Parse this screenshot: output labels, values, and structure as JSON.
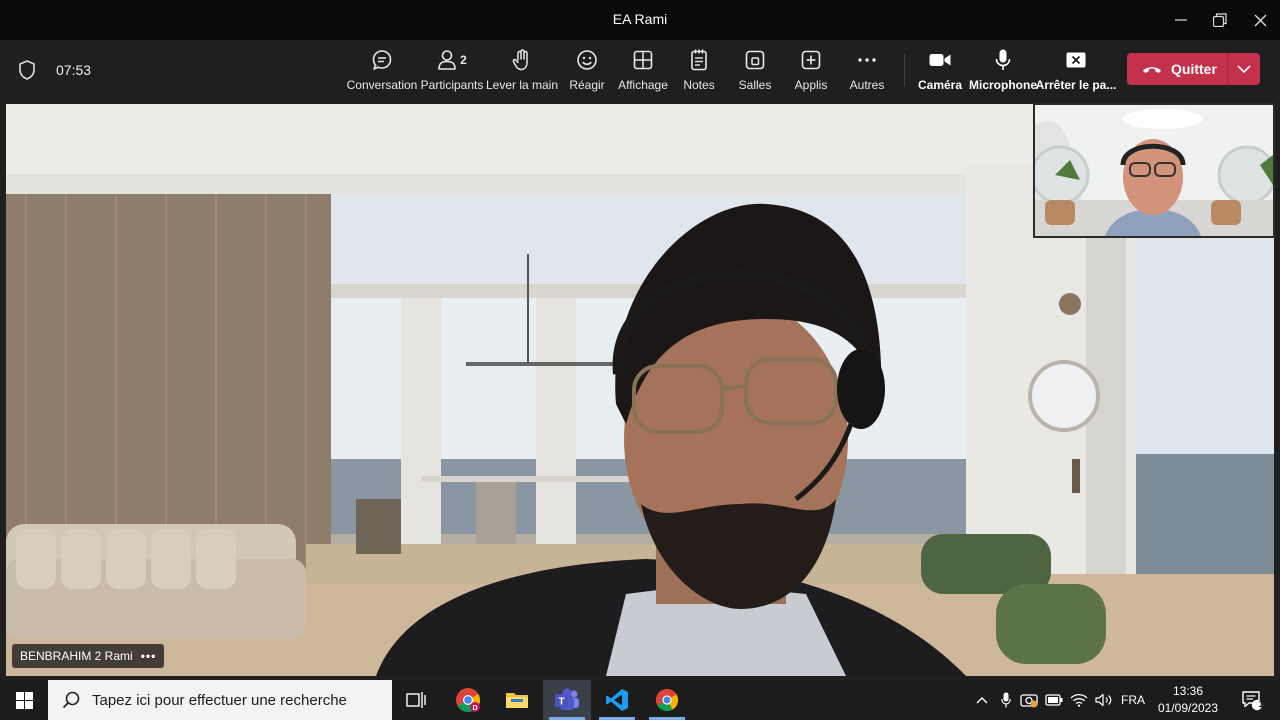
{
  "window": {
    "title": "EA Rami"
  },
  "meeting": {
    "elapsed": "07:53",
    "participants_count": "2",
    "toolbar": [
      {
        "key": "conversation",
        "label": "Conversation"
      },
      {
        "key": "participants",
        "label": "Participants"
      },
      {
        "key": "raise_hand",
        "label": "Lever la main"
      },
      {
        "key": "react",
        "label": "Réagir"
      },
      {
        "key": "view",
        "label": "Affichage"
      },
      {
        "key": "notes",
        "label": "Notes"
      },
      {
        "key": "rooms",
        "label": "Salles"
      },
      {
        "key": "apps",
        "label": "Applis"
      },
      {
        "key": "more",
        "label": "Autres"
      },
      {
        "key": "camera",
        "label": "Caméra"
      },
      {
        "key": "microphone",
        "label": "Microphone"
      },
      {
        "key": "share_stop",
        "label": "Arrêter le pa..."
      }
    ],
    "leave_label": "Quitter",
    "speaker_name": "BENBRAHIM 2 Rami",
    "more_dots": "•••"
  },
  "taskbar": {
    "search_placeholder": "Tapez ici pour effectuer une recherche",
    "language": "FRA",
    "time": "13:36",
    "date": "01/09/2023",
    "notification_count": "1"
  },
  "colors": {
    "leave_button": "#c4314b",
    "toolbar_bg": "#1f1f1f",
    "titlebar_bg": "#0a0a0a",
    "taskbar_bg": "#1c1c1c"
  }
}
